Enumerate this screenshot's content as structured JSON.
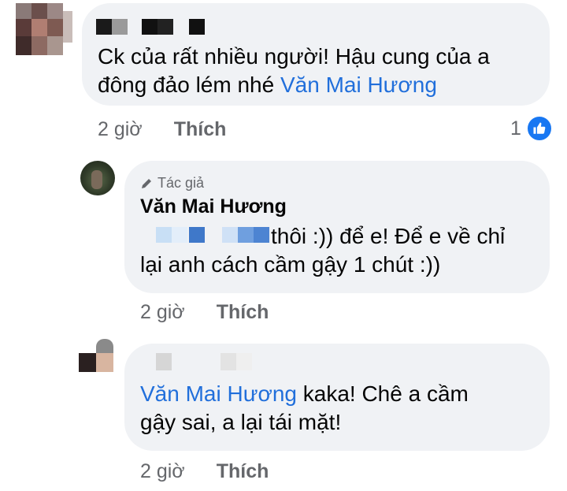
{
  "comments": [
    {
      "text_line1": "Ck của rất nhiều người! Hậu cung của a",
      "text_line2": "đông đảo lém nhé ",
      "mention": "Văn Mai Hương",
      "time": "2 giờ",
      "like_label": "Thích",
      "reaction_count": "1"
    },
    {
      "author_badge": "Tác giả",
      "author_name": "Văn Mai Hương",
      "text_line1": "thôi :)) để e! Để e về chỉ",
      "text_line2": "lại anh cách cầm gậy 1 chút :))",
      "time": "2 giờ",
      "like_label": "Thích"
    },
    {
      "mention": "Văn Mai Hương",
      "text_line1_rest": " kaka! Chê a cầm",
      "text_line2": "gậy sai, a lại tái mặt!",
      "time": "2 giờ",
      "like_label": "Thích"
    }
  ],
  "colors": {
    "bubble": "#f0f2f5",
    "mention": "#216fdb",
    "meta": "#65676b",
    "like_blue": "#1877f2"
  },
  "icons": [
    "pencil-icon",
    "like-thumb-icon"
  ]
}
